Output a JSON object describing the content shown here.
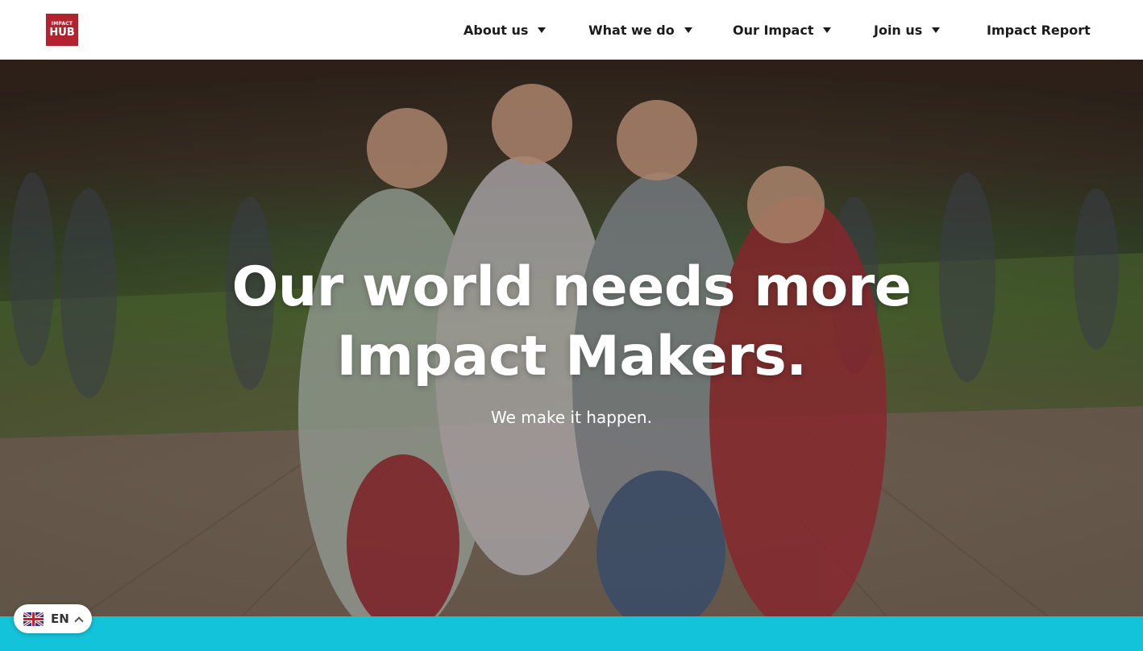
{
  "header": {
    "logo": {
      "line1": "IMPACT",
      "line2": "HUB",
      "color": "#b5222f"
    },
    "nav": [
      {
        "label": "About us",
        "has_dropdown": true
      },
      {
        "label": "What we do",
        "has_dropdown": true
      },
      {
        "label": "Our Impact",
        "has_dropdown": true
      },
      {
        "label": "Join us",
        "has_dropdown": true
      },
      {
        "label": "Impact Report",
        "has_dropdown": false
      }
    ]
  },
  "hero": {
    "headline_line1": "Our world needs more",
    "headline_line2": "Impact Makers.",
    "subline": "We make it happen."
  },
  "band": {
    "color": "#12c3d9"
  },
  "language_switcher": {
    "flag": "uk-flag-icon",
    "label": "EN",
    "icon": "chevron-up-icon"
  }
}
